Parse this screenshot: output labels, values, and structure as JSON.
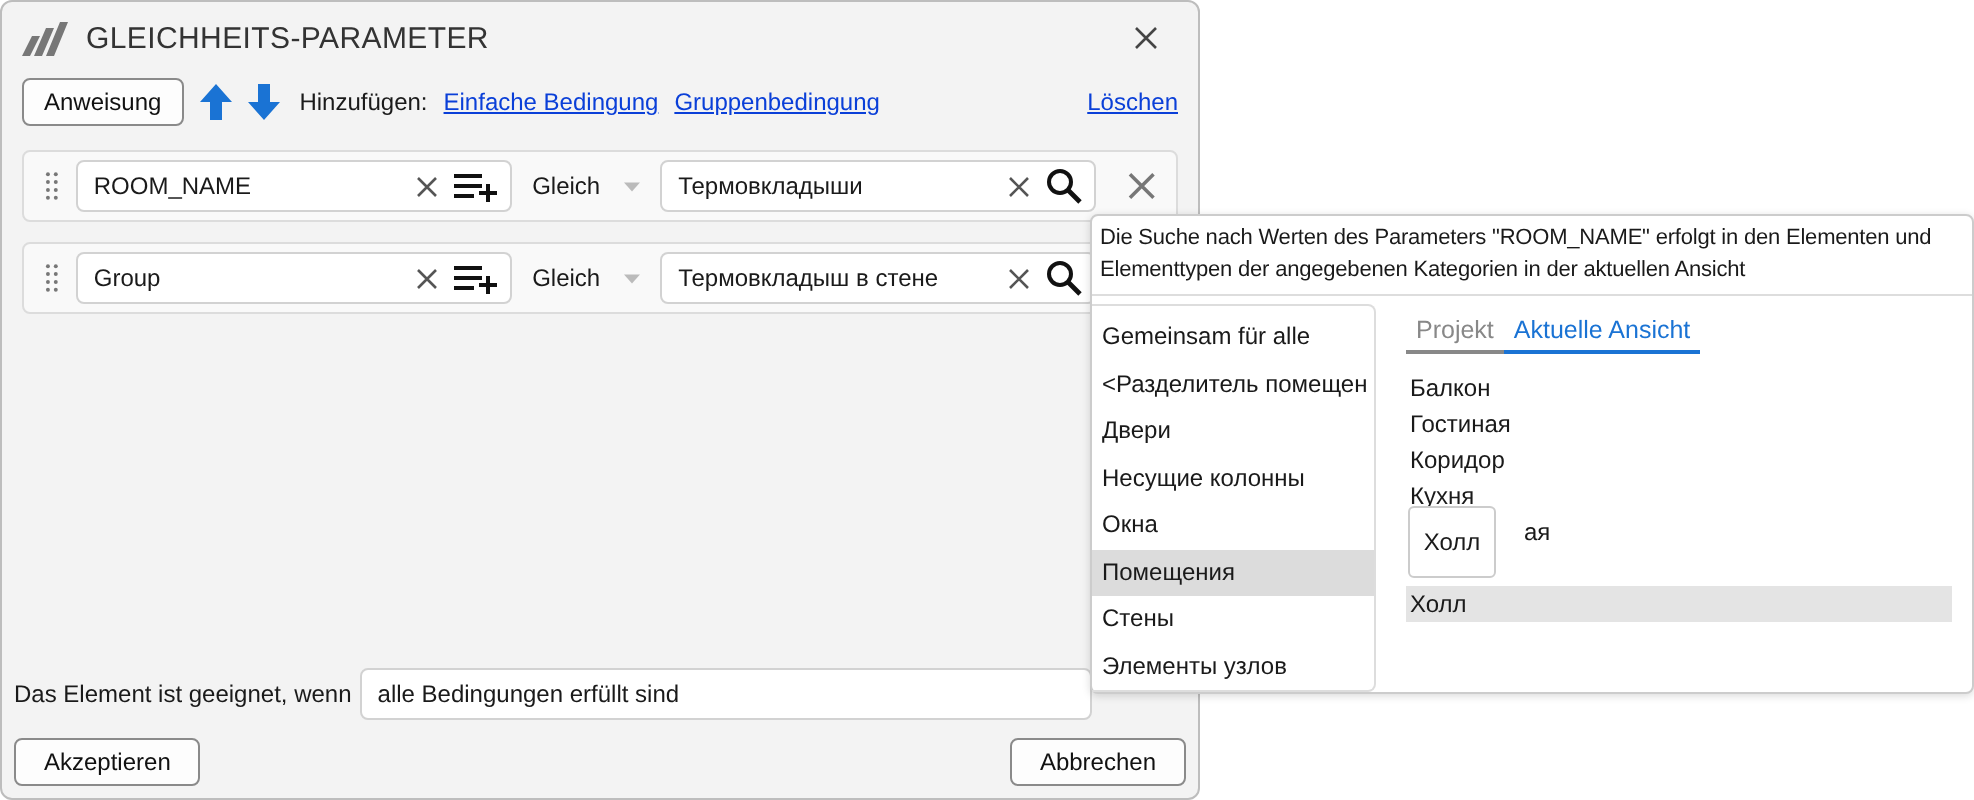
{
  "window": {
    "title": "GLEICHHEITS-PARAMETER"
  },
  "toolbar": {
    "button": "Anweisung",
    "add_label": "Hinzufügen:",
    "links": [
      "Einfache Bedingung",
      "Gruppenbedingung"
    ],
    "delete_link": "Löschen"
  },
  "conditions": [
    {
      "parameter": "ROOM_NAME",
      "operator": "Gleich",
      "value": "Термовкладыши",
      "delete_shown": true
    },
    {
      "parameter": "Group",
      "operator": "Gleich",
      "value": "Термовкладыш в стене"
    }
  ],
  "footer": {
    "label": "Das Element ist geeignet, wenn",
    "mode": "alle Bedingungen erfüllt sind",
    "buttons": [
      "Akzeptieren",
      "Abbrechen"
    ]
  },
  "popup": {
    "hint": "Die Suche nach Werten des Parameters \"ROOM_NAME\" erfolgt in den Elementen und Elementtypen der angegebenen Kategorien in der aktuellen Ansicht",
    "categories": [
      {
        "label": "Gemeinsam für alle",
        "selected": false
      },
      {
        "label": "<Разделитель помещен",
        "selected": false
      },
      {
        "label": "Двери",
        "selected": false
      },
      {
        "label": "Несущие колонны",
        "selected": false
      },
      {
        "label": "Окна",
        "selected": false
      },
      {
        "label": "Помещения",
        "selected": true
      },
      {
        "label": "Стены",
        "selected": false
      },
      {
        "label": "Элементы узлов",
        "selected": false
      }
    ],
    "tabs": [
      {
        "label": "Projekt",
        "selected": false
      },
      {
        "label": "Aktuelle Ansicht",
        "selected": true
      }
    ],
    "values": [
      {
        "label": "Балкон",
        "selected": false
      },
      {
        "label": "Гостиная",
        "selected": false
      },
      {
        "label": "Коридор",
        "selected": false
      },
      {
        "label": "Кухня",
        "selected": false
      },
      {
        "label": "ая",
        "selected": false
      },
      {
        "label": "Холл",
        "selected": true
      }
    ],
    "drag_tooltip": "Холл"
  }
}
